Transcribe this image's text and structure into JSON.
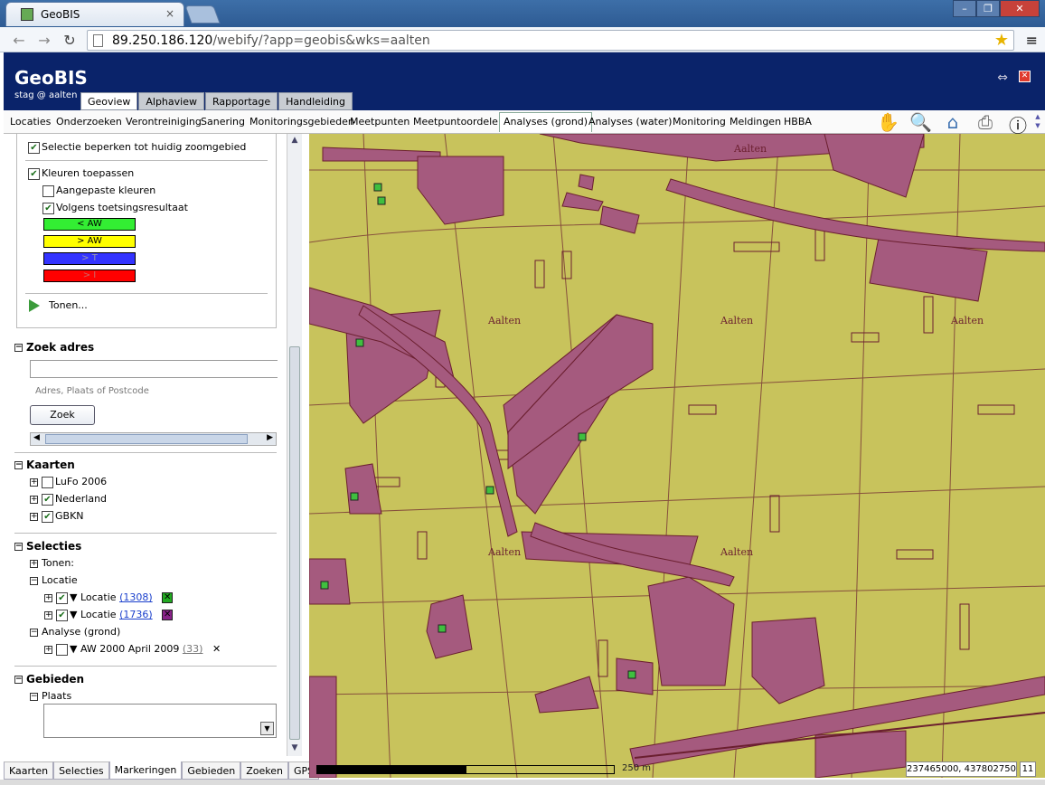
{
  "browser": {
    "tab_title": "GeoBIS",
    "tab_close": "×",
    "url_host": "89.250.186.120",
    "url_path": "/webify/?app=geobis&wks=aalten",
    "window_controls": [
      "–",
      "❐",
      "✕"
    ]
  },
  "header": {
    "app_title": "GeoBIS",
    "user": "stag @ aalten",
    "tabs": [
      "Geoview",
      "Alphaview",
      "Rapportage",
      "Handleiding"
    ],
    "active_tab": "Geoview"
  },
  "menu": {
    "items": [
      "Locaties",
      "Onderzoeken",
      "Verontreiniging",
      "Sanering",
      "Monitoringsgebieden",
      "Meetpunten",
      "Meetpuntoordelen",
      "Analyses (grond)",
      "Analyses (water)",
      "Monitoring",
      "Meldingen",
      "HBBA"
    ],
    "active_item": "Analyses (grond)",
    "tool_icons": [
      "pan-hand-icon",
      "zoom-magnifier-icon",
      "home-icon",
      "print-icon",
      "info-icon"
    ]
  },
  "panel": {
    "selectie_beperken": "Selectie beperken tot huidig zoomgebied",
    "kleuren_toepassen": "Kleuren toepassen",
    "aangepaste_kleuren": "Aangepaste kleuren",
    "volgens_toetsing": "Volgens toetsingsresultaat",
    "legend": [
      {
        "label": "< AW",
        "color": "#33ee33"
      },
      {
        "label": "> AW",
        "color": "#ffff00"
      },
      {
        "label": "> T",
        "color": "#3333ff"
      },
      {
        "label": "> I",
        "color": "#ff0000"
      }
    ],
    "tonen": "Tonen...",
    "zoek_adres": {
      "title": "Zoek adres",
      "input_value": "",
      "hint": "Adres, Plaats of Postcode",
      "button": "Zoek"
    },
    "kaarten": {
      "title": "Kaarten",
      "items": [
        {
          "label": "LuFo 2006",
          "checked": false
        },
        {
          "label": "Nederland",
          "checked": true
        },
        {
          "label": "GBKN",
          "checked": true
        }
      ]
    },
    "selecties": {
      "title": "Selecties",
      "tonen": "Tonen:",
      "locatie_group": "Locatie",
      "locaties": [
        {
          "label": "Locatie",
          "count": "(1308)",
          "marker_color": "#22aa22"
        },
        {
          "label": "Locatie",
          "count": "(1736)",
          "marker_color": "#882288"
        }
      ],
      "analyse_group": "Analyse (grond)",
      "analyse_item": {
        "label": "AW 2000 April 2009",
        "count": "(33)"
      }
    },
    "gebieden": {
      "title": "Gebieden",
      "plaats": "Plaats"
    }
  },
  "bottom_tabs": [
    "Kaarten",
    "Selecties",
    "Markeringen",
    "Gebieden",
    "Zoeken",
    "GPS"
  ],
  "bottom_active": "Markeringen",
  "map": {
    "place_labels": [
      "Aalten",
      "Aalten",
      "Aalten",
      "Aalten",
      "Aalten",
      "Aalten"
    ],
    "scale_label": "250 m",
    "coordinates": "237465000, 437802750",
    "zoom_level": "11",
    "colors": {
      "base": "#c8c35c",
      "parcel": "#a55a7e",
      "road": "#b06080",
      "outline": "#6b1f2f",
      "marker": "#3fbf3f"
    }
  }
}
